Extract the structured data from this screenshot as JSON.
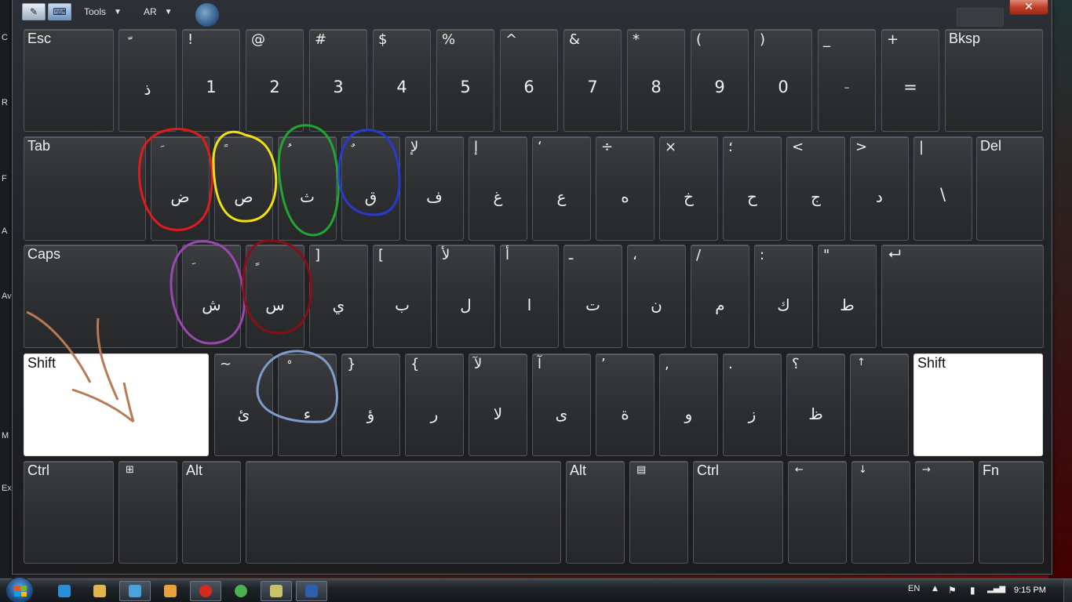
{
  "desktop": {
    "left_labels": [
      "C",
      "R",
      "F",
      "A",
      "Av",
      "",
      "M",
      "Ex"
    ]
  },
  "toolbar": {
    "tools_label": "Tools",
    "lang_label": "AR",
    "close_symbol": "✕"
  },
  "keys": [
    {
      "id": "esc",
      "label": "Esc"
    },
    {
      "id": "backtick",
      "shift": "ّ",
      "base": "ذ"
    },
    {
      "id": "1",
      "shift": "!",
      "base": "1"
    },
    {
      "id": "2",
      "shift": "@",
      "base": "2"
    },
    {
      "id": "3",
      "shift": "#",
      "base": "3"
    },
    {
      "id": "4",
      "shift": "$",
      "base": "4"
    },
    {
      "id": "5",
      "shift": "%",
      "base": "5"
    },
    {
      "id": "6",
      "shift": "^",
      "base": "6"
    },
    {
      "id": "7",
      "shift": "&",
      "base": "7"
    },
    {
      "id": "8",
      "shift": "*",
      "base": "8"
    },
    {
      "id": "9",
      "shift": "(",
      "base": "9"
    },
    {
      "id": "0",
      "shift": ")",
      "base": "0"
    },
    {
      "id": "minus",
      "shift": "_",
      "base": "-"
    },
    {
      "id": "equals",
      "shift": "+",
      "base": "="
    },
    {
      "id": "bksp",
      "label": "Bksp"
    },
    {
      "id": "tab",
      "label": "Tab"
    },
    {
      "id": "q",
      "shift": "َ",
      "base": "ض"
    },
    {
      "id": "w",
      "shift": "ً",
      "base": "ص"
    },
    {
      "id": "e",
      "shift": "ُ",
      "base": "ث"
    },
    {
      "id": "r",
      "shift": "ٌ",
      "base": "ق"
    },
    {
      "id": "t",
      "shift": "لإ",
      "base": "ف"
    },
    {
      "id": "y",
      "shift": "إ",
      "base": "غ"
    },
    {
      "id": "u",
      "shift": "‘",
      "base": "ع"
    },
    {
      "id": "i",
      "shift": "÷",
      "base": "ه"
    },
    {
      "id": "o",
      "shift": "×",
      "base": "خ"
    },
    {
      "id": "p",
      "shift": "؛",
      "base": "ح"
    },
    {
      "id": "lbracket",
      "shift": "<",
      "base": "ج"
    },
    {
      "id": "rbracket",
      "shift": ">",
      "base": "د"
    },
    {
      "id": "backslash",
      "shift": "|",
      "base": "\\"
    },
    {
      "id": "del",
      "label": "Del"
    },
    {
      "id": "caps",
      "label": "Caps"
    },
    {
      "id": "a",
      "shift": "ِ",
      "base": "ش"
    },
    {
      "id": "s",
      "shift": "ٍ",
      "base": "س"
    },
    {
      "id": "d",
      "shift": "]",
      "base": "ي"
    },
    {
      "id": "f",
      "shift": "[",
      "base": "ب"
    },
    {
      "id": "g",
      "shift": "لأ",
      "base": "ل"
    },
    {
      "id": "h",
      "shift": "أ",
      "base": "ا"
    },
    {
      "id": "j",
      "shift": "ـ",
      "base": "ت"
    },
    {
      "id": "k",
      "shift": "،",
      "base": "ن"
    },
    {
      "id": "l",
      "shift": "/",
      "base": "م"
    },
    {
      "id": "semicolon",
      "shift": ":",
      "base": "ك"
    },
    {
      "id": "quote",
      "shift": "\"",
      "base": "ط"
    },
    {
      "id": "enter",
      "icon": "⮠"
    },
    {
      "id": "lshift",
      "label": "Shift"
    },
    {
      "id": "z",
      "shift": "~",
      "base": "ئ"
    },
    {
      "id": "x",
      "shift": "ْ",
      "base": "ء"
    },
    {
      "id": "c",
      "shift": "}",
      "base": "ؤ"
    },
    {
      "id": "v",
      "shift": "{",
      "base": "ر"
    },
    {
      "id": "b",
      "shift": "لآ",
      "base": "لا"
    },
    {
      "id": "n",
      "shift": "آ",
      "base": "ى"
    },
    {
      "id": "m",
      "shift": "’",
      "base": "ة"
    },
    {
      "id": "comma",
      "shift": ",",
      "base": "و"
    },
    {
      "id": "period",
      "shift": ".",
      "base": "ز"
    },
    {
      "id": "slash",
      "shift": "؟",
      "base": "ظ"
    },
    {
      "id": "up",
      "icon": "↑"
    },
    {
      "id": "rshift",
      "label": "Shift"
    },
    {
      "id": "lctrl",
      "label": "Ctrl"
    },
    {
      "id": "win",
      "icon": "⊞"
    },
    {
      "id": "lalt",
      "label": "Alt"
    },
    {
      "id": "space",
      "label": ""
    },
    {
      "id": "ralt",
      "label": "Alt"
    },
    {
      "id": "menu",
      "icon": "▤"
    },
    {
      "id": "rctrl",
      "label": "Ctrl"
    },
    {
      "id": "left",
      "icon": "←"
    },
    {
      "id": "down",
      "icon": "↓"
    },
    {
      "id": "right",
      "icon": "→"
    },
    {
      "id": "fn",
      "label": "Fn"
    }
  ],
  "taskbar": {
    "language": "EN",
    "time": "9:15 PM",
    "tray_icons": [
      "show-hidden-icons",
      "action-center-icon",
      "power-icon",
      "network-icon"
    ],
    "apps": [
      "internet-explorer-icon",
      "windows-explorer-icon",
      "skype-icon",
      "media-player-icon",
      "opera-icon",
      "chrome-icon",
      "chat-icon",
      "word-icon"
    ]
  },
  "annotation_colors": {
    "q": "#e01b1b",
    "w": "#f0e014",
    "e": "#21a632",
    "r": "#2a39d0",
    "a": "#9a48b0",
    "s": "#8a0e18",
    "x": "#7e9ccc",
    "arrows": "#b87a55"
  }
}
